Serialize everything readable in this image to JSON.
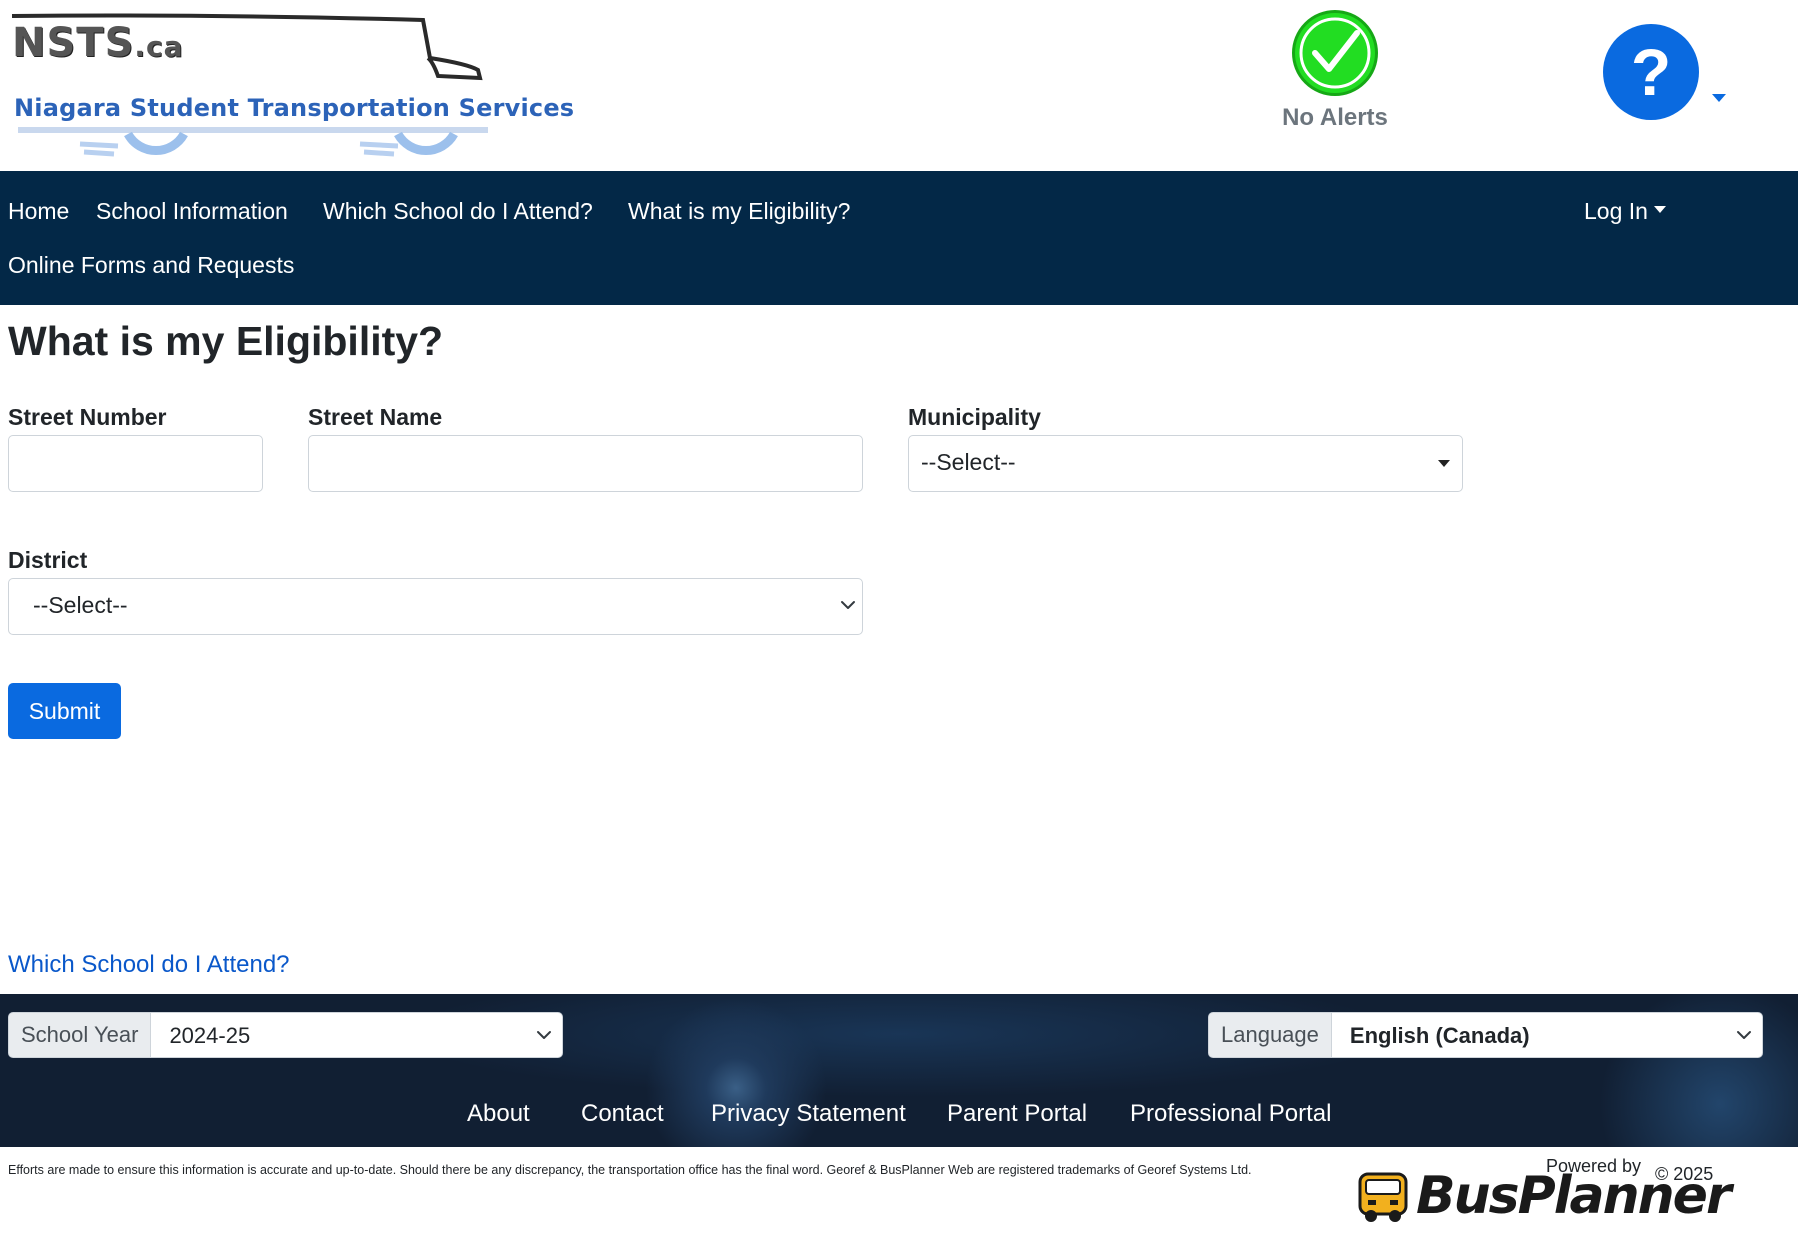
{
  "header": {
    "logo_top": "NSTS",
    "logo_top_suffix": ".ca",
    "logo_sub": "Niagara Student Transportation Services",
    "alert_label": "No Alerts",
    "help_symbol": "?"
  },
  "nav": {
    "items": [
      "Home",
      "School Information",
      "Which School do I Attend?",
      "What is my Eligibility?",
      "Online Forms and Requests"
    ],
    "login": "Log In"
  },
  "main": {
    "title": "What is my Eligibility?",
    "street_number_label": "Street Number",
    "street_number_value": "",
    "street_name_label": "Street Name",
    "street_name_value": "",
    "municipality_label": "Municipality",
    "municipality_value": "--Select--",
    "district_label": "District",
    "district_value": "--Select--",
    "submit": "Submit",
    "bottom_link": "Which School do I Attend?"
  },
  "footer": {
    "school_year_label": "School Year",
    "school_year_value": "2024-25",
    "language_label": "Language",
    "language_value": "English (Canada)",
    "links": [
      "About",
      "Contact",
      "Privacy Statement",
      "Parent Portal",
      "Professional Portal"
    ],
    "disclaimer": "Efforts are made to ensure this information is accurate and up-to-date. Should there be any discrepancy, the transportation office has the final word. Georef & BusPlanner Web are registered trademarks of Georef Systems Ltd.",
    "powered_by": "Powered by",
    "busplanner": "BusPlanner",
    "copyright": "© 2025"
  },
  "colors": {
    "navbar": "#032847",
    "primary": "#0a6ae0",
    "alert_ok": "#22dd22",
    "footer": "#111f33"
  }
}
